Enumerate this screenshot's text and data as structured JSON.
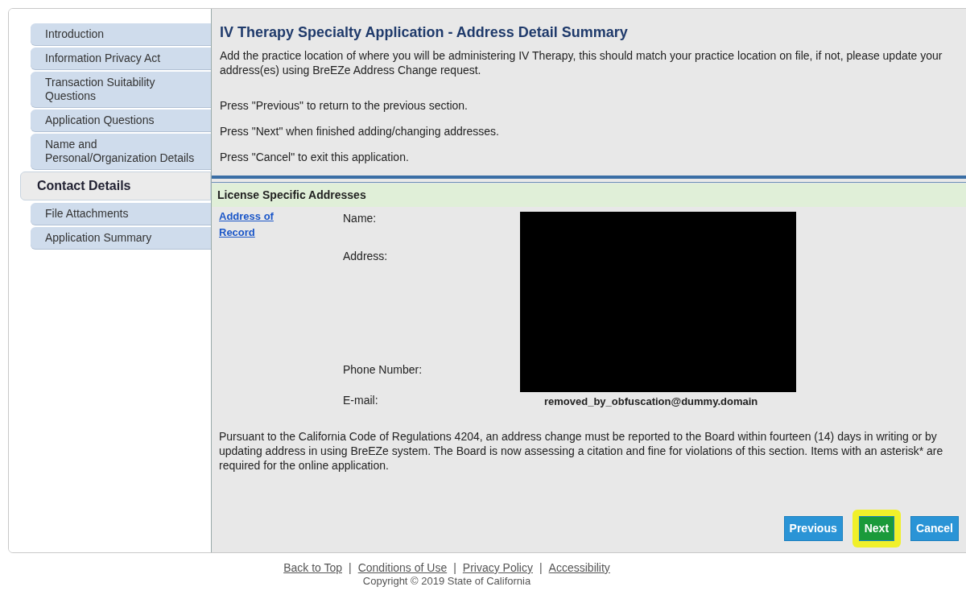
{
  "sidebar": {
    "items": [
      {
        "label": "Introduction",
        "selected": false
      },
      {
        "label": "Information Privacy Act",
        "selected": false
      },
      {
        "label": "Transaction Suitability Questions",
        "selected": false
      },
      {
        "label": "Application Questions",
        "selected": false
      },
      {
        "label": "Name and Personal/Organization Details",
        "selected": false
      },
      {
        "label": "Contact Details",
        "selected": true
      },
      {
        "label": "File Attachments",
        "selected": false
      },
      {
        "label": "Application Summary",
        "selected": false
      }
    ]
  },
  "main": {
    "title": "IV Therapy Specialty Application - Address Detail Summary",
    "intro": "Add the practice location of where you will be administering IV Therapy, this should match your practice location on file, if not, please update your address(es) using BreEZe Address Change request.",
    "instructions": [
      "Press \"Previous\" to return to the previous section.",
      "Press \"Next\" when finished adding/changing addresses.",
      "Press \"Cancel\" to exit this application."
    ],
    "section": {
      "title": "License Specific Addresses",
      "link": "Address of Record",
      "redacted": true,
      "fields": [
        {
          "label": "Name:"
        },
        {
          "label": "Address:"
        },
        {
          "label": "Phone Number:"
        },
        {
          "label": "E-mail:",
          "value": "removed_by_obfuscation@dummy.domain"
        }
      ]
    },
    "notice": "Pursuant to the California Code of Regulations 4204, an address change must be reported to the Board within fourteen (14) days in writing or by updating address in using BreEZe system. The Board is now assessing a citation and fine for violations of this section. Items with an asterisk* are required for the online application.",
    "buttons": [
      {
        "label": "Previous",
        "highlighted": false
      },
      {
        "label": "Next",
        "highlighted": true
      },
      {
        "label": "Cancel",
        "highlighted": false
      }
    ]
  },
  "footer": {
    "items": [
      {
        "kind": "link",
        "label": "Back to Top"
      },
      {
        "kind": "separator",
        "label": "|"
      },
      {
        "kind": "link",
        "label": "Conditions of Use"
      },
      {
        "kind": "separator",
        "label": "|"
      },
      {
        "kind": "link",
        "label": "Privacy Policy"
      },
      {
        "kind": "separator",
        "label": "|"
      },
      {
        "kind": "link",
        "label": "Accessibility"
      }
    ],
    "copyright": "Copyright © 2019 State of California"
  }
}
